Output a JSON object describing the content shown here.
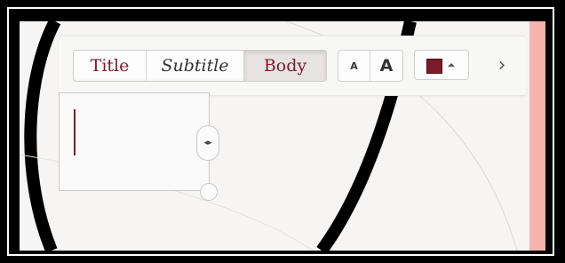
{
  "toolbar": {
    "style_tabs": [
      {
        "label": "Title",
        "selected": false
      },
      {
        "label": "Subtitle",
        "selected": false
      },
      {
        "label": "Body",
        "selected": true
      }
    ],
    "font_size": {
      "decrease_label": "A",
      "increase_label": "A"
    },
    "text_color": {
      "value": "#7a1c2e",
      "icon": "color-swatch",
      "dropdown_icon": "caret-up-icon"
    },
    "next_icon_glyph": "›"
  },
  "editor": {
    "resize_handle_glyph": "◂▸"
  },
  "colors": {
    "accent": "#7a1c2e",
    "pink_strip": "#f4b3ab",
    "canvas": "#f6f5f3"
  }
}
